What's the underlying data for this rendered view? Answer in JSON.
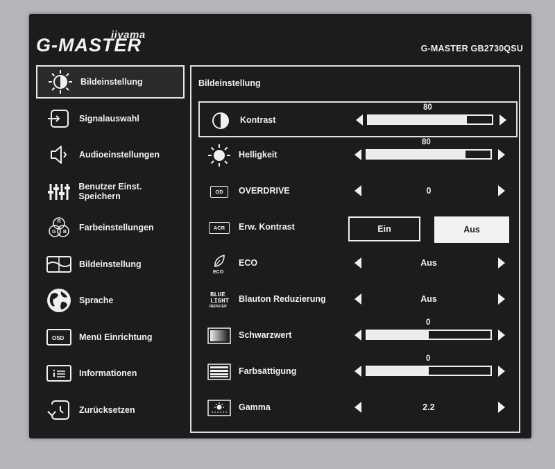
{
  "brand": {
    "maker": "iiyama",
    "logo": "G-MASTER",
    "model": "G-MASTER GB2730QSU"
  },
  "sidebar": {
    "items": [
      {
        "label": "Bildeinstellung",
        "icon": "picture-adjust-icon",
        "active": true
      },
      {
        "label": "Signalauswahl",
        "icon": "input-select-icon"
      },
      {
        "label": "Audioeinstellungen",
        "icon": "speaker-icon"
      },
      {
        "label": "Benutzer Einst. Speichern",
        "icon": "sliders-icon"
      },
      {
        "label": "Farbeinstellungen",
        "icon": "rgb-icon"
      },
      {
        "label": "Bildeinstellung",
        "icon": "image-settings-icon"
      },
      {
        "label": "Sprache",
        "icon": "globe-icon"
      },
      {
        "label": "Menü Einrichtung",
        "icon": "osd-icon"
      },
      {
        "label": "Informationen",
        "icon": "info-icon"
      },
      {
        "label": "Zurücksetzen",
        "icon": "reset-icon"
      }
    ]
  },
  "panel": {
    "title": "Bildeinstellung",
    "rows": [
      {
        "label": "Kontrast",
        "type": "slider",
        "value": "80",
        "fraction": 0.8
      },
      {
        "label": "Helligkeit",
        "type": "slider",
        "value": "80",
        "fraction": 0.8
      },
      {
        "label": "OVERDRIVE",
        "type": "select",
        "value": "0",
        "tag": "OD"
      },
      {
        "label": "Erw. Kontrast",
        "type": "toggle",
        "options": [
          "Ein",
          "Aus"
        ],
        "selected": "Aus",
        "tag": "ACR"
      },
      {
        "label": "ECO",
        "type": "select",
        "value": "Aus",
        "icon_text": "ECO"
      },
      {
        "label": "Blauton Reduzierung",
        "type": "select",
        "value": "Aus",
        "icon_text": [
          "BLUE",
          "LIGHT",
          "REDUCER"
        ]
      },
      {
        "label": "Schwarzwert",
        "type": "slider",
        "value": "0",
        "fraction": 0.5
      },
      {
        "label": "Farbsättigung",
        "type": "slider",
        "value": "0",
        "fraction": 0.5
      },
      {
        "label": "Gamma",
        "type": "select",
        "value": "2.2"
      }
    ]
  },
  "colors": {
    "background": "#1c1c1e",
    "text": "#f0f0f0",
    "frame": "#b4b6bb"
  }
}
